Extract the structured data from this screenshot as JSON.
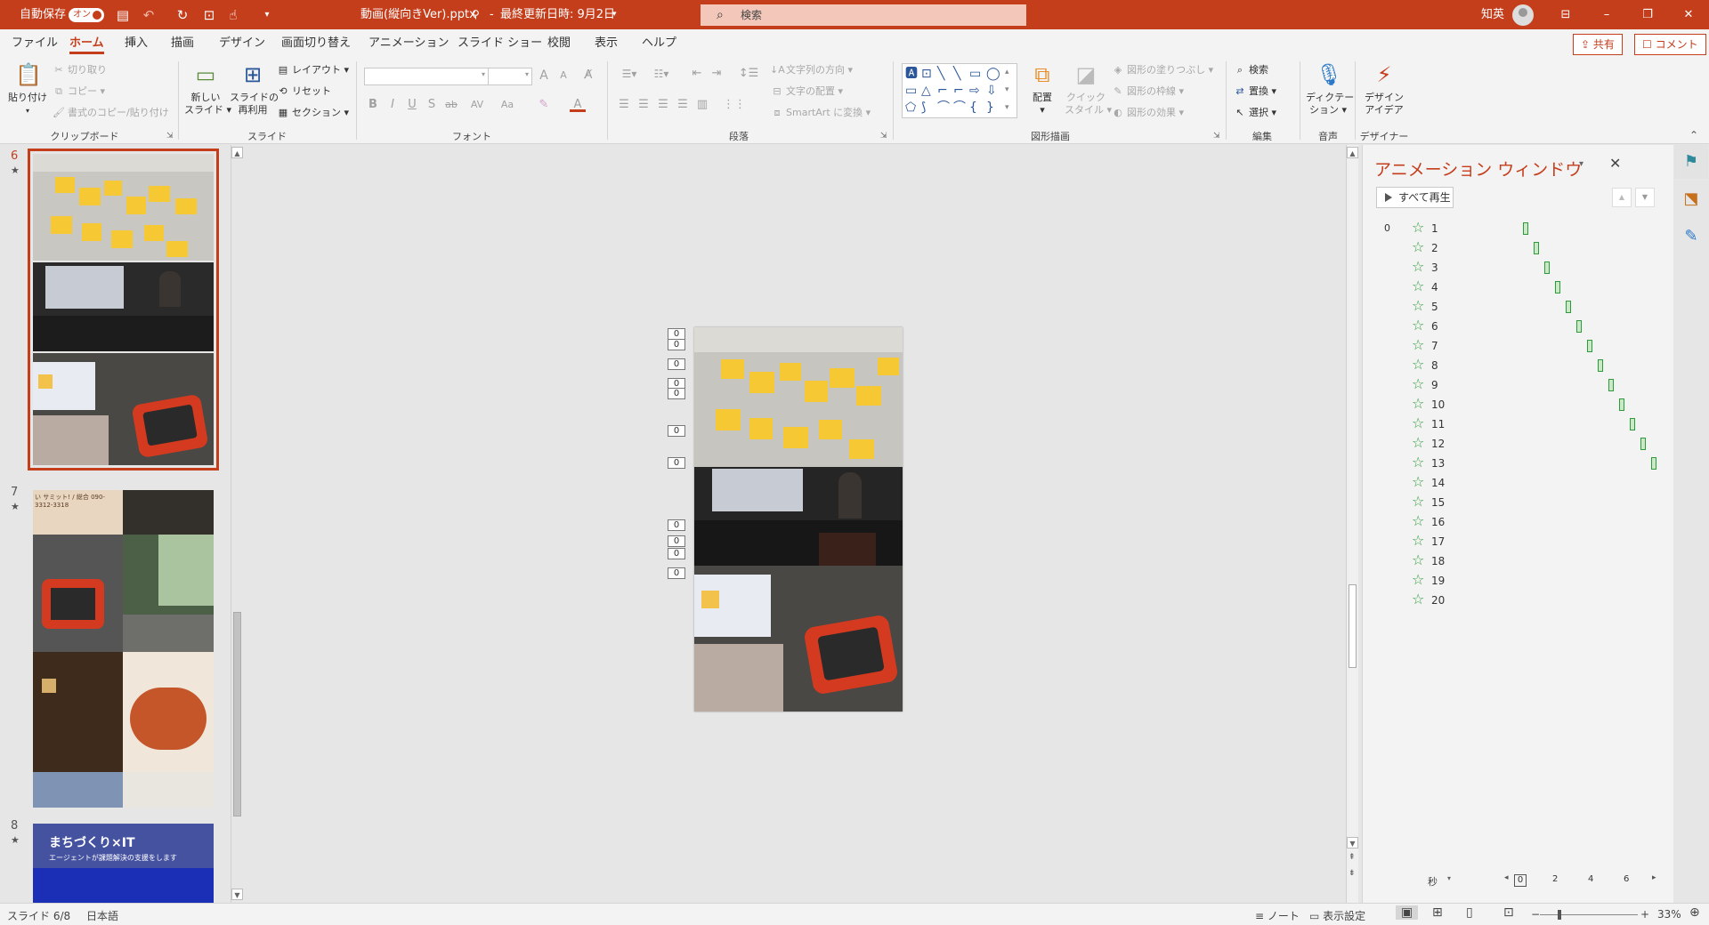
{
  "titlebar": {
    "autosave_label": "自動保存",
    "autosave_state": "オン",
    "filename": "動画(縦向きVer).pptx",
    "last_saved": "最終更新日時: 9月2日",
    "search_placeholder": "検索",
    "user_name": "知英"
  },
  "tabs": [
    "ファイル",
    "ホーム",
    "挿入",
    "描画",
    "デザイン",
    "画面切り替え",
    "アニメーション",
    "スライド ショー",
    "校閲",
    "表示",
    "ヘルプ"
  ],
  "active_tab": "ホーム",
  "share_label": "共有",
  "comment_label": "コメント",
  "ribbon": {
    "clipboard": {
      "paste": "貼り付け",
      "cut": "切り取り",
      "copy": "コピー",
      "format_painter": "書式のコピー/貼り付け",
      "group": "クリップボード"
    },
    "slides": {
      "new_slide_1": "新しい",
      "new_slide_2": "スライド",
      "reuse_1": "スライドの",
      "reuse_2": "再利用",
      "layout": "レイアウト",
      "reset": "リセット",
      "section": "セクション",
      "group": "スライド"
    },
    "font": {
      "bold": "B",
      "italic": "I",
      "underline": "U",
      "shadow": "S",
      "strike": "ab",
      "spacing": "AV",
      "case": "Aa",
      "grow": "A",
      "shrink": "A",
      "group": "フォント"
    },
    "paragraph": {
      "text_direction": "文字列の方向",
      "align_text": "文字の配置",
      "smartart": "SmartArt に変換",
      "group": "段落"
    },
    "drawing": {
      "arrange": "配置",
      "quick_style_1": "クイック",
      "quick_style_2": "スタイル",
      "fill": "図形の塗りつぶし",
      "outline": "図形の枠線",
      "effects": "図形の効果",
      "group": "図形描画"
    },
    "editing": {
      "find": "検索",
      "replace": "置換",
      "select": "選択",
      "group": "編集"
    },
    "voice": {
      "dictate_1": "ディクテー",
      "dictate_2": "ション",
      "group": "音声"
    },
    "designer": {
      "ideas_1": "デザイン",
      "ideas_2": "アイデア",
      "group": "デザイナー"
    }
  },
  "thumbnails": [
    {
      "number": "6",
      "star": "★"
    },
    {
      "number": "7",
      "star": "★"
    },
    {
      "number": "8",
      "star": "★",
      "title": "まちづくり×IT",
      "subtitle": "エージェントが課題解決の支援をします"
    }
  ],
  "slide7_sign": "い サミット! / 総合 090-3312-3318",
  "anim_tags": [
    "0",
    "0",
    "0",
    "0",
    "0",
    "0",
    "0",
    "0",
    "0",
    "0",
    "0"
  ],
  "animation_pane": {
    "title": "アニメーション ウィンドウ",
    "play_all": "すべて再生",
    "trigger_label": "0",
    "items": [
      "1",
      "2",
      "3",
      "4",
      "5",
      "6",
      "7",
      "8",
      "9",
      "10",
      "11",
      "12",
      "13",
      "14",
      "15",
      "16",
      "17",
      "18",
      "19",
      "20"
    ],
    "timeline_unit": "秒",
    "timeline_ticks": [
      "0",
      "2",
      "4",
      "6"
    ]
  },
  "statusbar": {
    "slide_info": "スライド 6/8",
    "language": "日本語",
    "notes": "ノート",
    "display_settings": "表示設定",
    "zoom": "33%"
  },
  "colors": {
    "accent": "#c43e1c",
    "anim_green": "#2e9b3b"
  }
}
